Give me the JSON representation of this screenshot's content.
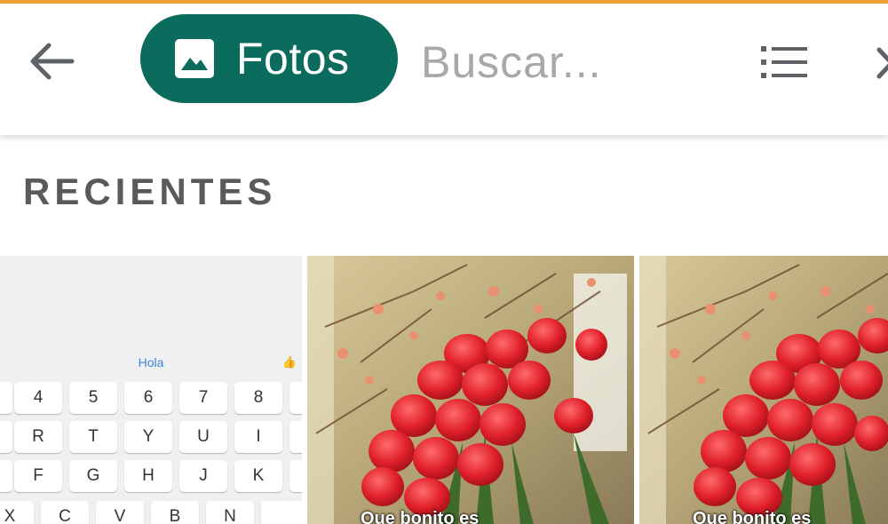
{
  "app": {
    "accent_color": "#f0a035",
    "chip_color": "#0b6b5d"
  },
  "toolbar": {
    "back_icon": "arrow-left-icon",
    "chip_label": "Fotos",
    "chip_icon": "image-icon",
    "search_placeholder": "Buscar...",
    "list_icon": "list-icon",
    "close_icon": "close-icon"
  },
  "section": {
    "title": "RECIENTES"
  },
  "thumbnails": [
    {
      "kind": "keyboard-screenshot",
      "suggestion": "Hola",
      "rows": [
        [
          "4",
          "5",
          "6",
          "7",
          "8"
        ],
        [
          "R",
          "T",
          "Y",
          "U",
          "I"
        ],
        [
          "F",
          "G",
          "H",
          "J",
          "K"
        ],
        [
          "X",
          "C",
          "V",
          "B",
          "N"
        ]
      ]
    },
    {
      "kind": "tulips-photo",
      "caption": "Que bonito es"
    },
    {
      "kind": "tulips-photo",
      "caption": "Que bonito es"
    }
  ]
}
